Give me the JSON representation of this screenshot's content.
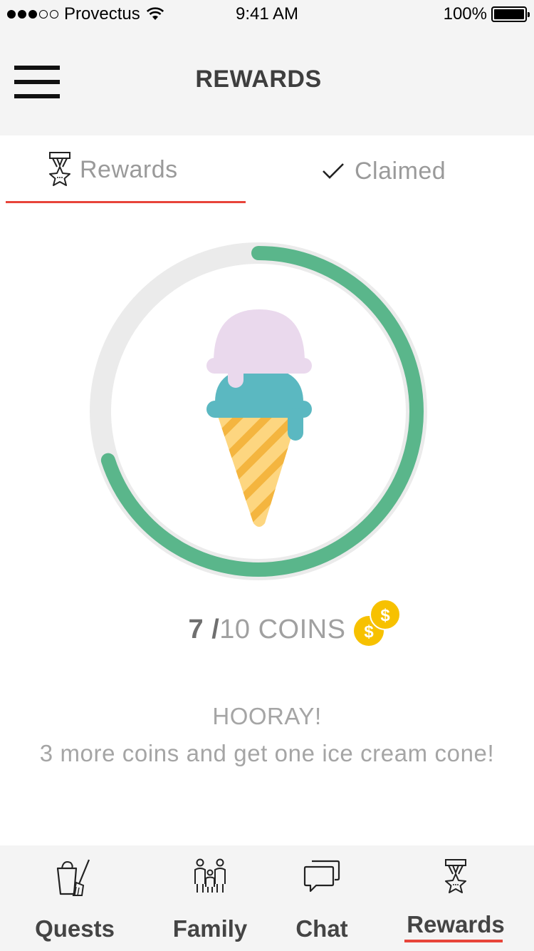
{
  "status_bar": {
    "carrier": "Provectus",
    "time": "9:41 AM",
    "battery": "100%"
  },
  "nav": {
    "title": "REWARDS",
    "menu_icon": "hamburger-menu-icon"
  },
  "tabs": [
    {
      "label": "Rewards",
      "icon": "medal-icon",
      "active": true
    },
    {
      "label": "Claimed",
      "icon": "checkmark-icon",
      "active": false
    }
  ],
  "progress": {
    "current": 7,
    "total": 10,
    "current_label": "7 /",
    "total_label": "10 COINS",
    "track_color": "#ebebeb",
    "fill_color": "#5ab68b",
    "reward_icon": "ice-cream-cone-icon"
  },
  "message": {
    "title": "HOORAY!",
    "body": "3 more coins and get one ice cream cone!"
  },
  "tab_bar": [
    {
      "label": "Quests",
      "icon": "bucket-broom-icon",
      "active": false
    },
    {
      "label": "Family",
      "icon": "family-icon",
      "active": false
    },
    {
      "label": "Chat",
      "icon": "chat-bubbles-icon",
      "active": false
    },
    {
      "label": "Rewards",
      "icon": "medal-icon",
      "active": true
    }
  ],
  "colors": {
    "accent": "#e8443a",
    "progress_fill": "#5ab68b",
    "coin": "#f7c100",
    "scoop_top": "#ead9ed",
    "scoop_bottom": "#5bb8c1",
    "cone": "#fdd680",
    "cone_stripe": "#f4b53f"
  }
}
